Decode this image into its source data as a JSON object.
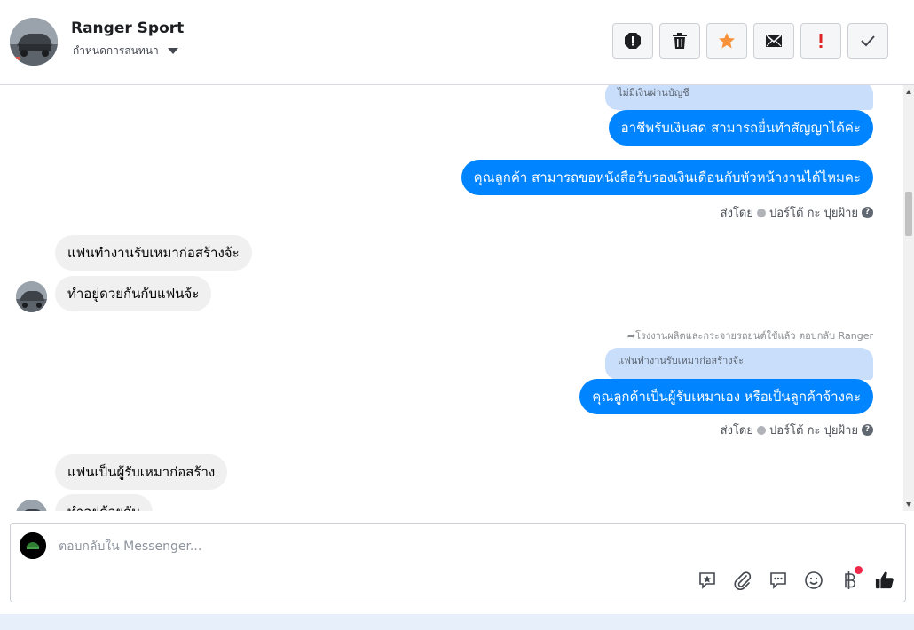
{
  "header": {
    "contact_name": "Ranger Sport",
    "contact_sub": "กำหนดการสนทนา",
    "toolbar": [
      {
        "name": "report-button",
        "icon": "alert-circle-icon"
      },
      {
        "name": "delete-button",
        "icon": "trash-icon"
      },
      {
        "name": "star-button",
        "icon": "star-icon"
      },
      {
        "name": "mail-button",
        "icon": "envelope-icon"
      },
      {
        "name": "important-button",
        "icon": "exclamation-icon"
      },
      {
        "name": "done-button",
        "icon": "check-icon"
      }
    ]
  },
  "messages": {
    "quote1": "ไม่มีเงินผ่านบัญชี",
    "out1": "อาชีพรับเงินสด สามารถยื่นทำสัญญาได้ค่ะ",
    "out2": "คุณลูกค้า สามารถขอหนังสือรับรองเงินเดือนกับหัวหน้างานได้ไหมคะ",
    "sent_by_label": "ส่งโดย",
    "sender_name": "ปอร์โต้ กะ ปุยฝ้าย",
    "in1": "แฟนทำงานรับเหมาก่อสร้างจ้ะ",
    "in2": "ทำอยู่ดวยกันกับแฟนจ้ะ",
    "reply_note": "โรงงานผลิตและกระจายรถยนต์ใช้แล้ว ตอบกลับ Ranger",
    "quote2": "แฟนทำงานรับเหมาก่อสร้างจ้ะ",
    "out3": "คุณลูกค้าเป็นผู้รับเหมาเอง หรือเป็นลูกค้าจ้างคะ",
    "in3": "แฟนเป็นผู้รับเหมาก่อสร้าง",
    "in4": "ทำอยู่ด้วยกัน"
  },
  "composer": {
    "placeholder": "ตอบกลับใน Messenger...",
    "icons": [
      "saved-reply-icon",
      "attachment-icon",
      "chat-bubble-icon",
      "emoji-icon",
      "baht-icon",
      "like-icon"
    ]
  },
  "colors": {
    "outgoing_bubble": "#0084ff",
    "incoming_bubble": "#f0f0f0",
    "quote_bubble": "#c9defa",
    "star": "#f7923b",
    "exclamation": "#e02424"
  }
}
